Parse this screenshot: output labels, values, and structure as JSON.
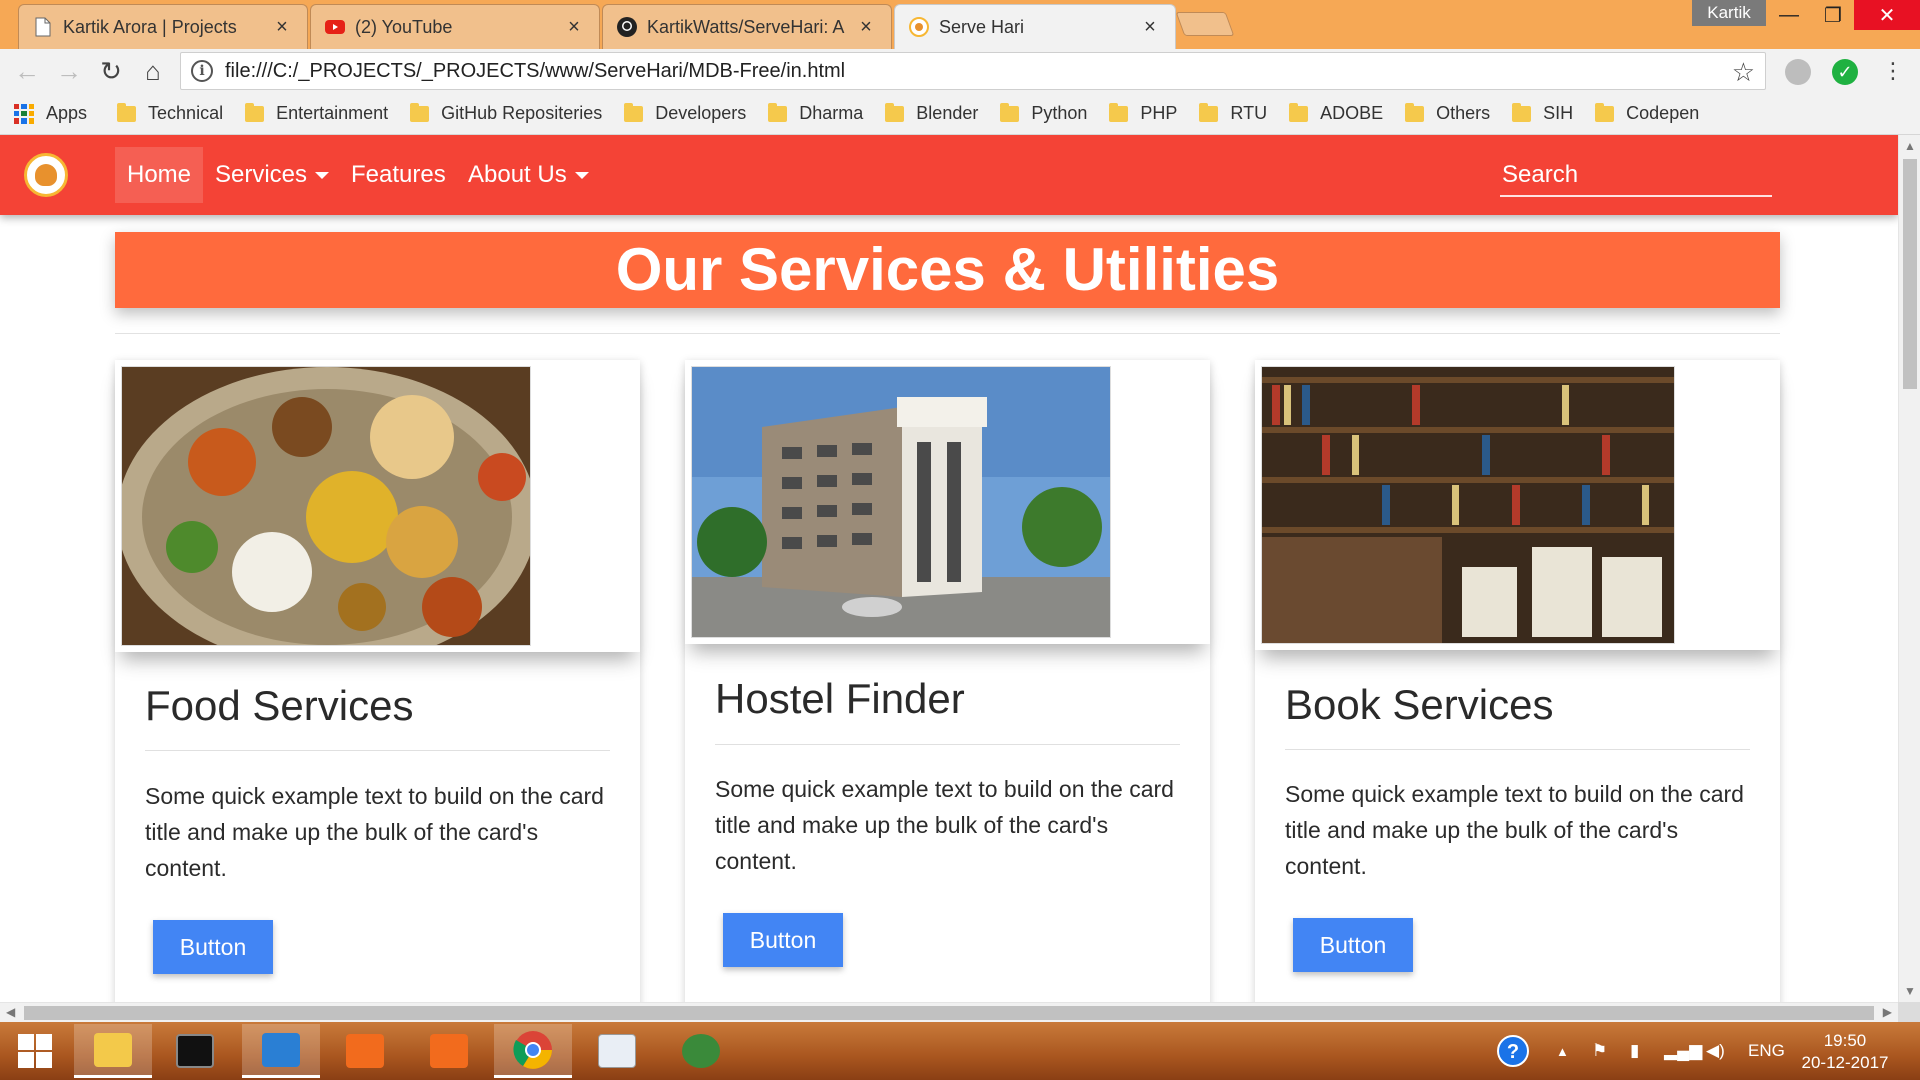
{
  "browser": {
    "tabs": [
      {
        "title": "Kartik Arora | Projects",
        "icon": "page-icon",
        "active": false
      },
      {
        "title": "(2) YouTube",
        "icon": "youtube-icon",
        "active": false
      },
      {
        "title": "KartikWatts/ServeHari: A",
        "icon": "github-icon",
        "active": false
      },
      {
        "title": "Serve Hari",
        "icon": "servehari-favicon",
        "active": true
      }
    ],
    "profile_name": "Kartik",
    "url": "file:///C:/_PROJECTS/_PROJECTS/www/ServeHari/MDB-Free/in.html",
    "bookmarks": [
      "Apps",
      "Technical",
      "Entertainment",
      "GitHub Repositeries",
      "Developers",
      "Dharma",
      "Blender",
      "Python",
      "PHP",
      "RTU",
      "ADOBE",
      "Others",
      "SIH",
      "Codepen"
    ]
  },
  "site": {
    "brand_color": "#f44336",
    "nav": [
      "Home",
      "Services",
      "Features",
      "About Us"
    ],
    "search_placeholder": "Search",
    "headline": "Our Services & Utilities",
    "cards": [
      {
        "title": "Food Services",
        "text": "Some quick example text to build on the card title and make up the bulk of the card's content.",
        "button": "Button",
        "image": "indian-thali-food-photo"
      },
      {
        "title": "Hostel Finder",
        "text": "Some quick example text to build on the card title and make up the bulk of the card's content.",
        "button": "Button",
        "image": "hostel-building-photo"
      },
      {
        "title": "Book Services",
        "text": "Some quick example text to build on the card title and make up the bulk of the card's content.",
        "button": "Button",
        "image": "bookshelves-photo"
      }
    ]
  },
  "taskbar": {
    "apps": [
      "windows-start-icon",
      "file-explorer-icon",
      "command-prompt-icon",
      "vscode-icon",
      "screen-capture-icon",
      "camera-app-icon",
      "chrome-icon",
      "python-file-icon",
      "network-globe-icon"
    ],
    "language": "ENG",
    "time": "19:50",
    "date": "20-12-2017"
  }
}
